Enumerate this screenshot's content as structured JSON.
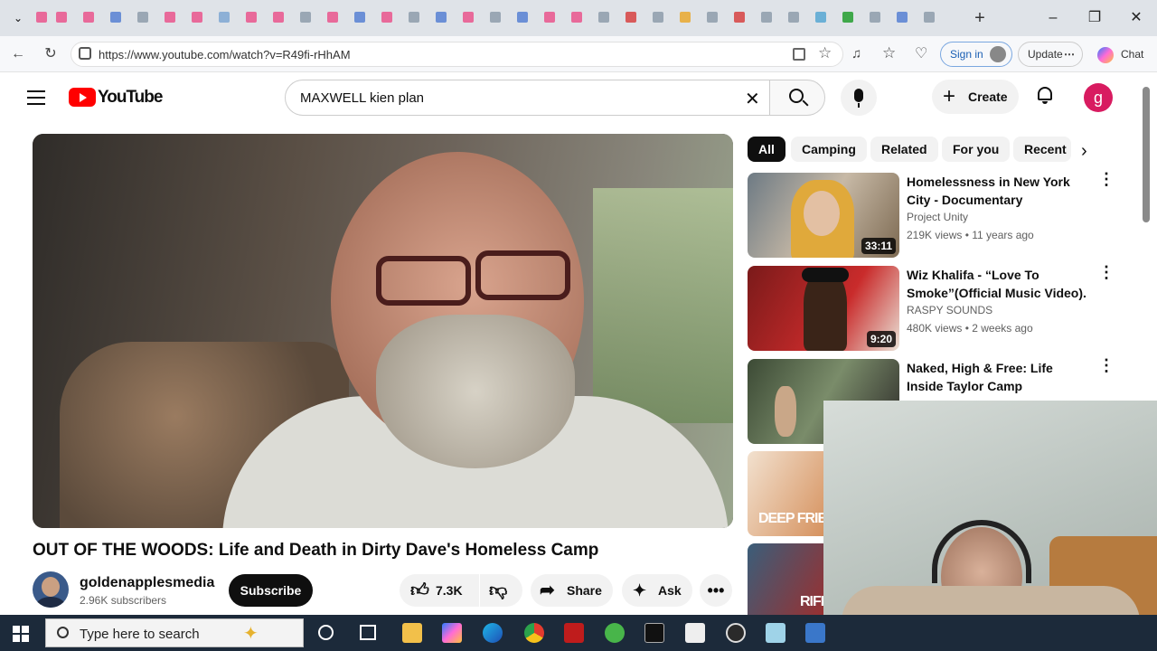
{
  "browser": {
    "url": "https://www.youtube.com/watch?v=R49fi-rHhAM",
    "sign_in_label": "Sign in",
    "update_label": "Update",
    "chat_label": "Chat"
  },
  "youtube": {
    "logo_text": "YouTube",
    "search_value": "MAXWELL kien plan",
    "create_label": "Create",
    "avatar_letter": "g"
  },
  "video": {
    "title": "OUT OF THE WOODS: Life and Death in Dirty Dave's Homeless Camp",
    "channel_name": "goldenapplesmedia",
    "subscribers": "2.96K subscribers",
    "subscribe_label": "Subscribe",
    "likes": "7.3K",
    "share_label": "Share",
    "ask_label": "Ask"
  },
  "chips": [
    "All",
    "Camping",
    "Related",
    "For you",
    "Recent"
  ],
  "recommendations": [
    {
      "title": "Homelessness in New York City - Documentary",
      "channel": "Project Unity",
      "meta": "219K views • 11 years ago",
      "duration": "33:11"
    },
    {
      "title": "Wiz Khalifa - “Love To Smoke”(Official Music Video).",
      "channel": "RASPY SOUNDS",
      "meta": "480K views • 2 weeks ago",
      "duration": "9:20"
    },
    {
      "title": "Naked, High & Free: Life Inside Taylor Camp",
      "channel": "",
      "meta": "",
      "duration": ""
    },
    {
      "title": "",
      "channel": "",
      "meta": "",
      "duration": "",
      "thumb_text": "DEEP FRIE"
    },
    {
      "title": "",
      "channel": "",
      "meta": "",
      "duration": "",
      "thumb_text": "RIFF"
    }
  ],
  "taskbar": {
    "search_placeholder": "Type here to search"
  },
  "colors": {
    "youtube_red": "#ff0000",
    "subscribe_bg": "#0f0f0f",
    "taskbar_bg": "#1c2a3a"
  }
}
